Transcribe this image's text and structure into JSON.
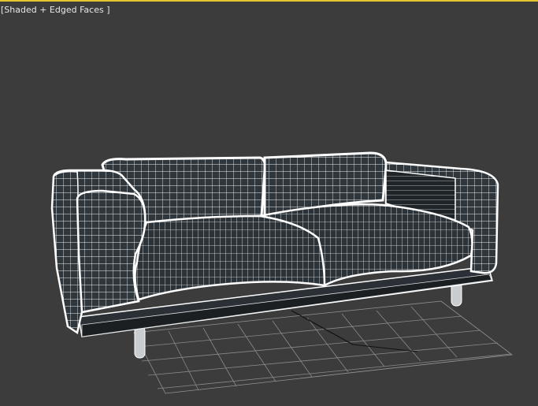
{
  "viewport": {
    "label": "[Shaded + Edged Faces ]",
    "active_border_color": "#e6c531",
    "background_color": "#3c3c3c",
    "render_mode": "Shaded + Edged Faces"
  },
  "scene": {
    "object": "sofa-3d-model",
    "grid_color": "#8a8a8a",
    "wire_color": "#ffffff",
    "surface_color": "#2e353b"
  }
}
